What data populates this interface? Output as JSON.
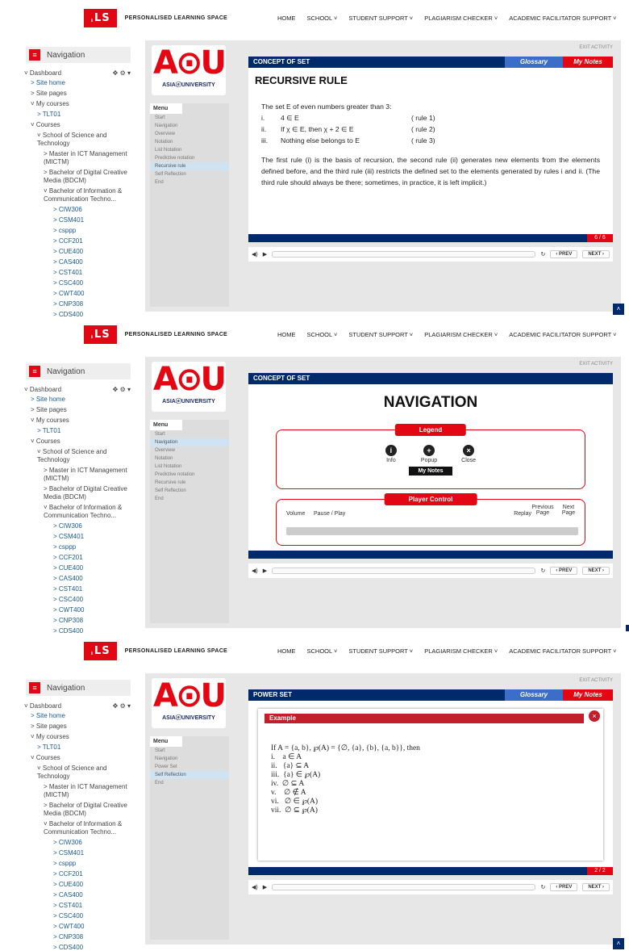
{
  "topbar": {
    "brand": "PERSONALISED LEARNING SPACE",
    "logo": "ˌLS",
    "nav": [
      "HOME",
      "SCHOOL ˅",
      "STUDENT SUPPORT ˅",
      "PLAGIARISM CHECKER ˅",
      "ACADEMIC FACILITATOR SUPPORT ˅"
    ]
  },
  "sidebar": {
    "title": "Navigation",
    "dashboard": "˅ Dashboard",
    "items": [
      {
        "label": "> Site home",
        "lvl": 1,
        "link": true
      },
      {
        "label": "> Site pages",
        "lvl": 1,
        "link": false
      },
      {
        "label": "˅ My courses",
        "lvl": 1,
        "link": false
      },
      {
        "label": "> TLT01",
        "lvl": 2,
        "link": true
      },
      {
        "label": "˅ Courses",
        "lvl": 1,
        "link": false
      },
      {
        "label": "˅ School of Science and Technology",
        "lvl": 2,
        "link": false
      },
      {
        "label": "> Master in ICT Management (MICTM)",
        "lvl": 3,
        "link": false
      },
      {
        "label": "> Bachelor of Digital Creative Media (BDCM)",
        "lvl": 3,
        "link": false
      },
      {
        "label": "˅ Bachelor of Information & Communication Techno...",
        "lvl": 3,
        "link": false
      },
      {
        "label": "> CIW306",
        "lvl": 4,
        "link": true
      },
      {
        "label": "> CSM401",
        "lvl": 4,
        "link": true
      },
      {
        "label": "> csppp",
        "lvl": 4,
        "link": true
      },
      {
        "label": "> CCF201",
        "lvl": 4,
        "link": true
      },
      {
        "label": "> CUE400",
        "lvl": 4,
        "link": true
      },
      {
        "label": "> CAS400",
        "lvl": 4,
        "link": true
      },
      {
        "label": "> CST401",
        "lvl": 4,
        "link": true
      },
      {
        "label": "> CSC400",
        "lvl": 4,
        "link": true
      },
      {
        "label": "> CWT400",
        "lvl": 4,
        "link": true
      },
      {
        "label": "> CNP308",
        "lvl": 4,
        "link": true
      },
      {
        "label": "> CDS400",
        "lvl": 4,
        "link": true
      }
    ]
  },
  "course": {
    "logo_big": "A⊙U",
    "logo_small": "ASIAⓔUNIVERSITY",
    "menu_label": "Menu",
    "exit": "EXIT ACTIVITY",
    "glossary": "Glossary",
    "my_notes": "My Notes",
    "prev": "‹ PREV",
    "next": "NEXT ›"
  },
  "panel1": {
    "menu": [
      "Start",
      "Navigation",
      "Overview",
      "Notation",
      "List Notation",
      "Predictive notation",
      "Recursive rule",
      "Self Reflection",
      "End"
    ],
    "selected": 6,
    "header": "CONCEPT OF SET",
    "title": "RECURSIVE RULE",
    "intro": "The set E of even numbers greater than 3:",
    "rules": [
      {
        "n": "i.",
        "t": "4 ∈ E",
        "r": "( rule 1)"
      },
      {
        "n": "ii.",
        "t": "If  χ ∈ E, then χ + 2  ∈ E",
        "r": "( rule 2)"
      },
      {
        "n": "iii.",
        "t": "Nothing else belongs to E",
        "r": "( rule 3)"
      }
    ],
    "para": "The first rule (i) is the basis of recursion, the second rule (ii) generates new elements from the elements defined before, and the third rule (iii) restricts the defined set to the elements generated by rules i and ii. (The third rule should always be there; sometimes, in practice, it is left implicit.)",
    "page": "6 / 6"
  },
  "panel2": {
    "menu": [
      "Start",
      "Navigation",
      "Overview",
      "Notation",
      "List Notation",
      "Predictive notation",
      "Recursive rule",
      "Self Reflection",
      "End"
    ],
    "selected": 1,
    "header": "CONCEPT OF SET",
    "title": "NAVIGATION",
    "legend": "Legend",
    "info": "Info",
    "popup": "Popup",
    "close": "Close",
    "my_notes": "My Notes",
    "player_control": "Player Control",
    "volume": "Volume",
    "pause_play": "Pause / Play",
    "replay": "Replay",
    "previous_page": "Previous Page",
    "next_page": "Next Page"
  },
  "panel3": {
    "menu": [
      "Start",
      "Navigation",
      "Power Set",
      "Self Reflection",
      "End"
    ],
    "selected": 3,
    "header": "POWER SET",
    "example": "Example",
    "lines": [
      "If A = {a, b}, ℘(A) = {∅, {a}, {b}, {a, b}}, then",
      "i.    a ∈ A",
      "ii.   {a} ⊆ A",
      "iii.  {a} ∈ ℘(A)",
      "iv.  ∅ ⊆ A",
      "v.    ∅ ∉ A",
      "vi.   ∅ ∈ ℘(A)",
      "vii.  ∅ ⊆ ℘(A)"
    ],
    "page": "2 / 2"
  },
  "colors": {
    "accent": "#e30613",
    "navy": "#002a6b",
    "glossary": "#3a6ec8"
  }
}
